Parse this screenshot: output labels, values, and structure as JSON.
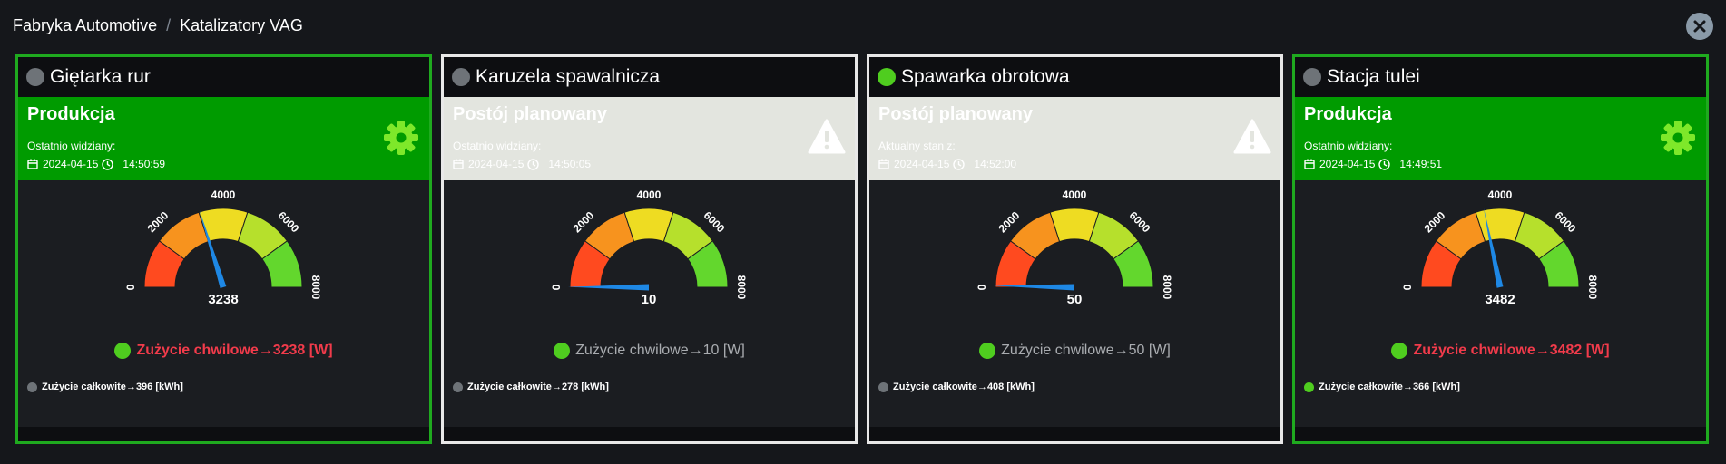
{
  "breadcrumb": {
    "root": "Fabryka Automotive",
    "separator": "/",
    "current": "Katalizatory VAG"
  },
  "close_icon": "close-icon",
  "gauge": {
    "min": 0,
    "max": 8000,
    "ticks": [
      "0",
      "2000",
      "4000",
      "6000",
      "8000"
    ],
    "band_colors": [
      "#ff4a1f",
      "#f7931e",
      "#eedc22",
      "#b6e02c",
      "#63d72d"
    ],
    "needle_color": "#1e88e5"
  },
  "cards": [
    {
      "title": "Giętarka rur",
      "status_dot": "gray",
      "border": "green",
      "status": {
        "kind": "production",
        "title": "Produkcja",
        "label": "Ostatnio widziany:",
        "date": "2024-04-15",
        "time": "14:50:59",
        "icon": "gear-icon"
      },
      "gauge_value": 3238,
      "gauge_label": "3238",
      "metric": {
        "dot": "green",
        "style": "alert",
        "text": "Zużycie chwilowe",
        "arrow": "→",
        "value": "3238 [W]"
      },
      "total": {
        "dot": "gray",
        "text": "Zużycie całkowite",
        "arrow": "→",
        "value": "396 [kWh]"
      }
    },
    {
      "title": "Karuzela spawalnicza",
      "status_dot": "gray",
      "border": "white",
      "status": {
        "kind": "planned",
        "title": "Postój planowany",
        "label": "Ostatnio widziany:",
        "date": "2024-04-15",
        "time": "14:50:05",
        "icon": "warning-icon"
      },
      "gauge_value": 10,
      "gauge_label": "10",
      "metric": {
        "dot": "green",
        "style": "muted",
        "text": "Zużycie chwilowe",
        "arrow": "→",
        "value": "10 [W]"
      },
      "total": {
        "dot": "gray",
        "text": "Zużycie całkowite",
        "arrow": "→",
        "value": "278 [kWh]"
      }
    },
    {
      "title": "Spawarka obrotowa",
      "status_dot": "green",
      "border": "white",
      "status": {
        "kind": "planned",
        "title": "Postój planowany",
        "label": "Aktualny stan z:",
        "date": "2024-04-15",
        "time": "14:52:00",
        "icon": "warning-icon"
      },
      "gauge_value": 50,
      "gauge_label": "50",
      "metric": {
        "dot": "green",
        "style": "muted",
        "text": "Zużycie chwilowe",
        "arrow": "→",
        "value": "50 [W]"
      },
      "total": {
        "dot": "gray",
        "text": "Zużycie całkowite",
        "arrow": "→",
        "value": "408 [kWh]"
      }
    },
    {
      "title": "Stacja tulei",
      "status_dot": "gray",
      "border": "green",
      "status": {
        "kind": "production",
        "title": "Produkcja",
        "label": "Ostatnio widziany:",
        "date": "2024-04-15",
        "time": "14:49:51",
        "icon": "gear-icon"
      },
      "gauge_value": 3482,
      "gauge_label": "3482",
      "metric": {
        "dot": "green",
        "style": "alert",
        "text": "Zużycie chwilowe",
        "arrow": "→",
        "value": "3482 [W]"
      },
      "total": {
        "dot": "green",
        "text": "Zużycie całkowite",
        "arrow": "→",
        "value": "366 [kWh]"
      }
    }
  ]
}
